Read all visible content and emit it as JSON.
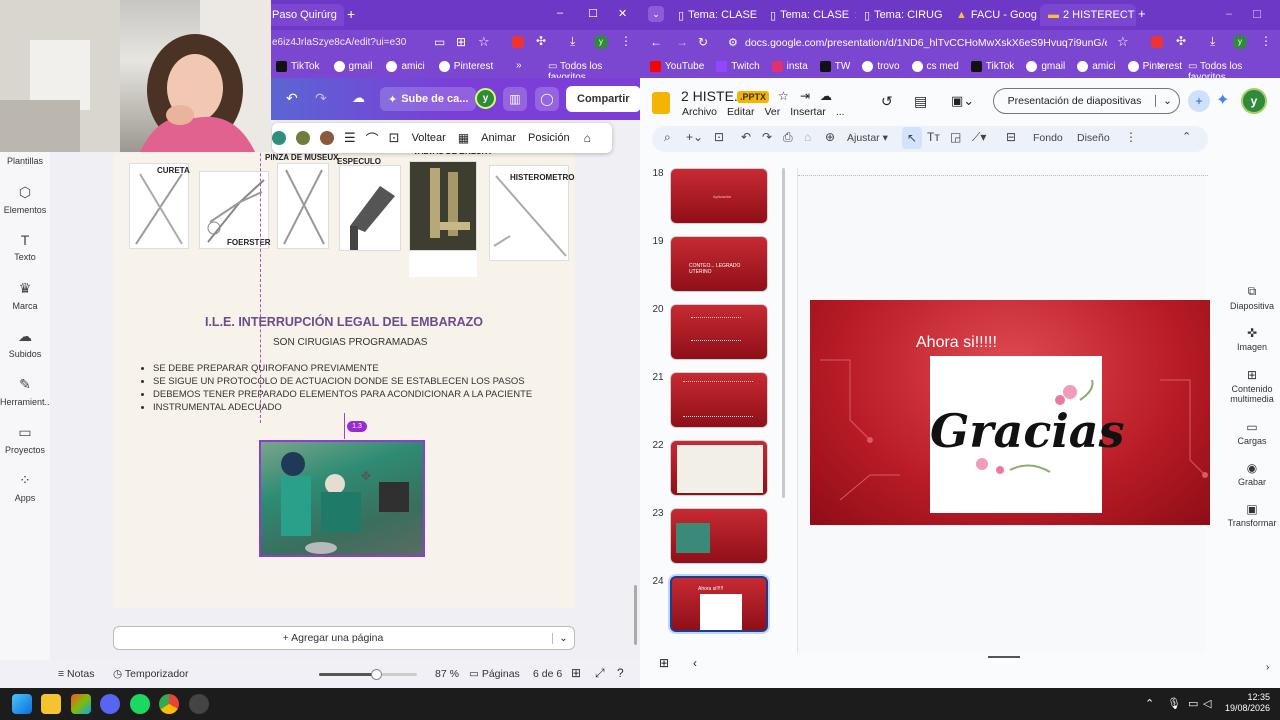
{
  "left": {
    "tabs": [
      {
        "label": "Paso Quirúrg",
        "active": true
      }
    ],
    "new_tab": "+",
    "window_controls": [
      "–",
      "☐",
      "✕"
    ],
    "address": "e6iz4JrlaSzye8cA/edit?ui=e30",
    "bookmarks": [
      "TikTok",
      "gmail",
      "amici",
      "Pinterest"
    ],
    "bookmarks_more": "»",
    "bookmarks_all": "Todos los favoritos",
    "toolbar": {
      "upload_label": "Sube de ca...",
      "avatar": "y",
      "share_label": "Compartir"
    },
    "sidebar": {
      "items": [
        {
          "label": "Plantillas",
          "icon": "templates-icon"
        },
        {
          "label": "Elementos",
          "icon": "elements-icon"
        },
        {
          "label": "Texto",
          "icon": "text-icon"
        },
        {
          "label": "Marca",
          "icon": "brand-icon"
        },
        {
          "label": "Subidos",
          "icon": "upload-icon"
        },
        {
          "label": "Herramient...",
          "icon": "tools-icon"
        },
        {
          "label": "Proyectos",
          "icon": "folder-icon"
        },
        {
          "label": "Apps",
          "icon": "apps-icon"
        }
      ]
    },
    "edit_toolbar": {
      "colors": [
        "#2f8f7a",
        "#6e7d3e",
        "#8a5a3c"
      ],
      "flip": "Voltear",
      "animate": "Animar",
      "position": "Posición"
    },
    "page": {
      "instrument_labels": [
        "CURETA",
        "FOERSTER",
        "PINZA DE MUSEUX",
        "ESPECULO",
        "VALVAS DE BRESKY",
        "HISTEROMETRO"
      ],
      "title": "I.L.E. INTERRUPCIÓN LEGAL DEL EMBARAZO",
      "subtitle": "SON CIRUGIAS PROGRAMADAS",
      "bullets": [
        "SE DEBE PREPARAR QUIROFANO PREVIAMENTE",
        "SE SIGUE UN PROTOCOLO DE ACTUACION DONDE SE ESTABLECEN LOS PASOS",
        "DEBEMOS TENER PREPARADO ELEMENTOS PARA ACONDICIONAR A LA PACIENTE",
        "INSTRUMENTAL ADECUADO"
      ],
      "image_badge": "1.3"
    },
    "add_page": "+ Agregar una página",
    "bottom": {
      "notes": "Notas",
      "timer": "Temporizador",
      "zoom": "87 %",
      "zoom_fraction": 0.58,
      "pages_label": "Páginas",
      "page_count": "6 de 6"
    }
  },
  "right": {
    "tabs": [
      {
        "label": "Tema: CLASE",
        "active": false
      },
      {
        "label": "Tema: CLASE",
        "active": false
      },
      {
        "label": "Tema: CIRUG",
        "active": false
      },
      {
        "label": "FACU - Goog",
        "active": false
      },
      {
        "label": "2 HISTERECT",
        "active": true
      }
    ],
    "address": "docs.google.com/presentation/d/1ND6_hlTvCCHoMwXskX6eS9Hvuq7i9unG/edit?slide=...",
    "bookmarks": [
      "YouTube",
      "Twitch",
      "insta",
      "TW",
      "trovo",
      "cs med",
      "TikTok",
      "gmail",
      "amici",
      "Pinterest"
    ],
    "bookmarks_more": "»",
    "bookmarks_all": "Todos los favoritos",
    "doc": {
      "title": "2 HISTE...",
      "badge": ".PPTX",
      "menus": [
        "Archivo",
        "Editar",
        "Ver",
        "Insertar",
        "..."
      ],
      "present_label": "Presentación de diapositivas",
      "avatar": "y"
    },
    "toolbar": {
      "fit": "Ajustar",
      "background": "Fondo",
      "design": "Diseño"
    },
    "slides": [
      {
        "num": "18",
        "text": "Aplicación"
      },
      {
        "num": "19",
        "text": "CONTEO... LEGRADO UTERINO"
      },
      {
        "num": "20",
        "text": ""
      },
      {
        "num": "21",
        "text": ""
      },
      {
        "num": "22",
        "text": ""
      },
      {
        "num": "23",
        "text": ""
      },
      {
        "num": "24",
        "text": "Ahora si!!!!!"
      }
    ],
    "main_slide": {
      "heading": "Ahora si!!!!!",
      "image_text": "Gracias"
    },
    "panel": [
      {
        "label": "Diapositiva",
        "icon": "slide-add-icon"
      },
      {
        "label": "Imagen",
        "icon": "image-icon"
      },
      {
        "label": "Contenido multimedia",
        "icon": "media-icon"
      },
      {
        "label": "Cargas",
        "icon": "folder-icon"
      },
      {
        "label": "Grabar",
        "icon": "record-icon"
      },
      {
        "label": "Transformar",
        "icon": "transform-icon"
      }
    ]
  },
  "taskbar": {
    "time": "12:35",
    "date": "19/08/2026"
  }
}
